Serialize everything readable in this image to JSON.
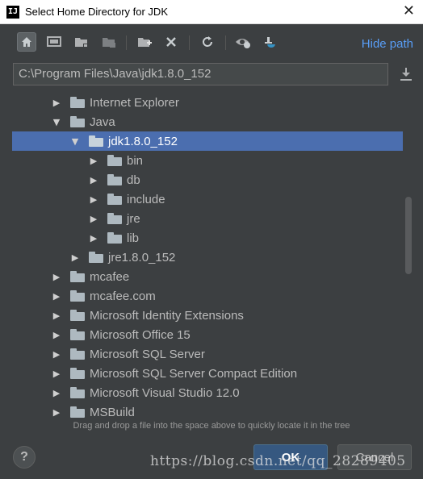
{
  "window": {
    "icon_text": "IJ",
    "title": "Select Home Directory for JDK",
    "close": "✕"
  },
  "toolbar": {
    "buttons": [
      {
        "icon": "home-icon",
        "active": true
      },
      {
        "icon": "desktop-icon"
      },
      {
        "icon": "project-icon"
      },
      {
        "icon": "module-icon"
      },
      {
        "icon": "new-folder-icon"
      },
      {
        "icon": "delete-icon"
      },
      {
        "icon": "refresh-icon"
      },
      {
        "icon": "show-hidden-icon"
      },
      {
        "icon": "jdk-icon"
      }
    ],
    "hide_path": "Hide path"
  },
  "path": {
    "value": "C:\\Program Files\\Java\\jdk1.8.0_152"
  },
  "tree": {
    "items": [
      {
        "label": "Internet Explorer",
        "depth": 1,
        "state": "collapsed"
      },
      {
        "label": "Java",
        "depth": 1,
        "state": "expanded"
      },
      {
        "label": "jdk1.8.0_152",
        "depth": 2,
        "state": "expanded",
        "selected": true
      },
      {
        "label": "bin",
        "depth": 3,
        "state": "collapsed"
      },
      {
        "label": "db",
        "depth": 3,
        "state": "collapsed"
      },
      {
        "label": "include",
        "depth": 3,
        "state": "collapsed"
      },
      {
        "label": "jre",
        "depth": 3,
        "state": "collapsed"
      },
      {
        "label": "lib",
        "depth": 3,
        "state": "collapsed"
      },
      {
        "label": "jre1.8.0_152",
        "depth": 2,
        "state": "collapsed"
      },
      {
        "label": "mcafee",
        "depth": 1,
        "state": "collapsed"
      },
      {
        "label": "mcafee.com",
        "depth": 1,
        "state": "collapsed"
      },
      {
        "label": "Microsoft Identity Extensions",
        "depth": 1,
        "state": "collapsed"
      },
      {
        "label": "Microsoft Office 15",
        "depth": 1,
        "state": "collapsed"
      },
      {
        "label": "Microsoft SQL Server",
        "depth": 1,
        "state": "collapsed"
      },
      {
        "label": "Microsoft SQL Server Compact Edition",
        "depth": 1,
        "state": "collapsed"
      },
      {
        "label": "Microsoft Visual Studio 12.0",
        "depth": 1,
        "state": "collapsed"
      },
      {
        "label": "MSBuild",
        "depth": 1,
        "state": "collapsed"
      }
    ]
  },
  "hint": "Drag and drop a file into the space above to quickly locate it in the tree",
  "footer": {
    "help": "?",
    "ok": "OK",
    "cancel": "Cancel"
  },
  "watermark": "https://blog.csdn.net/qq_28289405",
  "colors": {
    "background": "#3c3f41",
    "selection": "#4b6eaf",
    "link": "#589df6",
    "ok_button": "#365880"
  }
}
